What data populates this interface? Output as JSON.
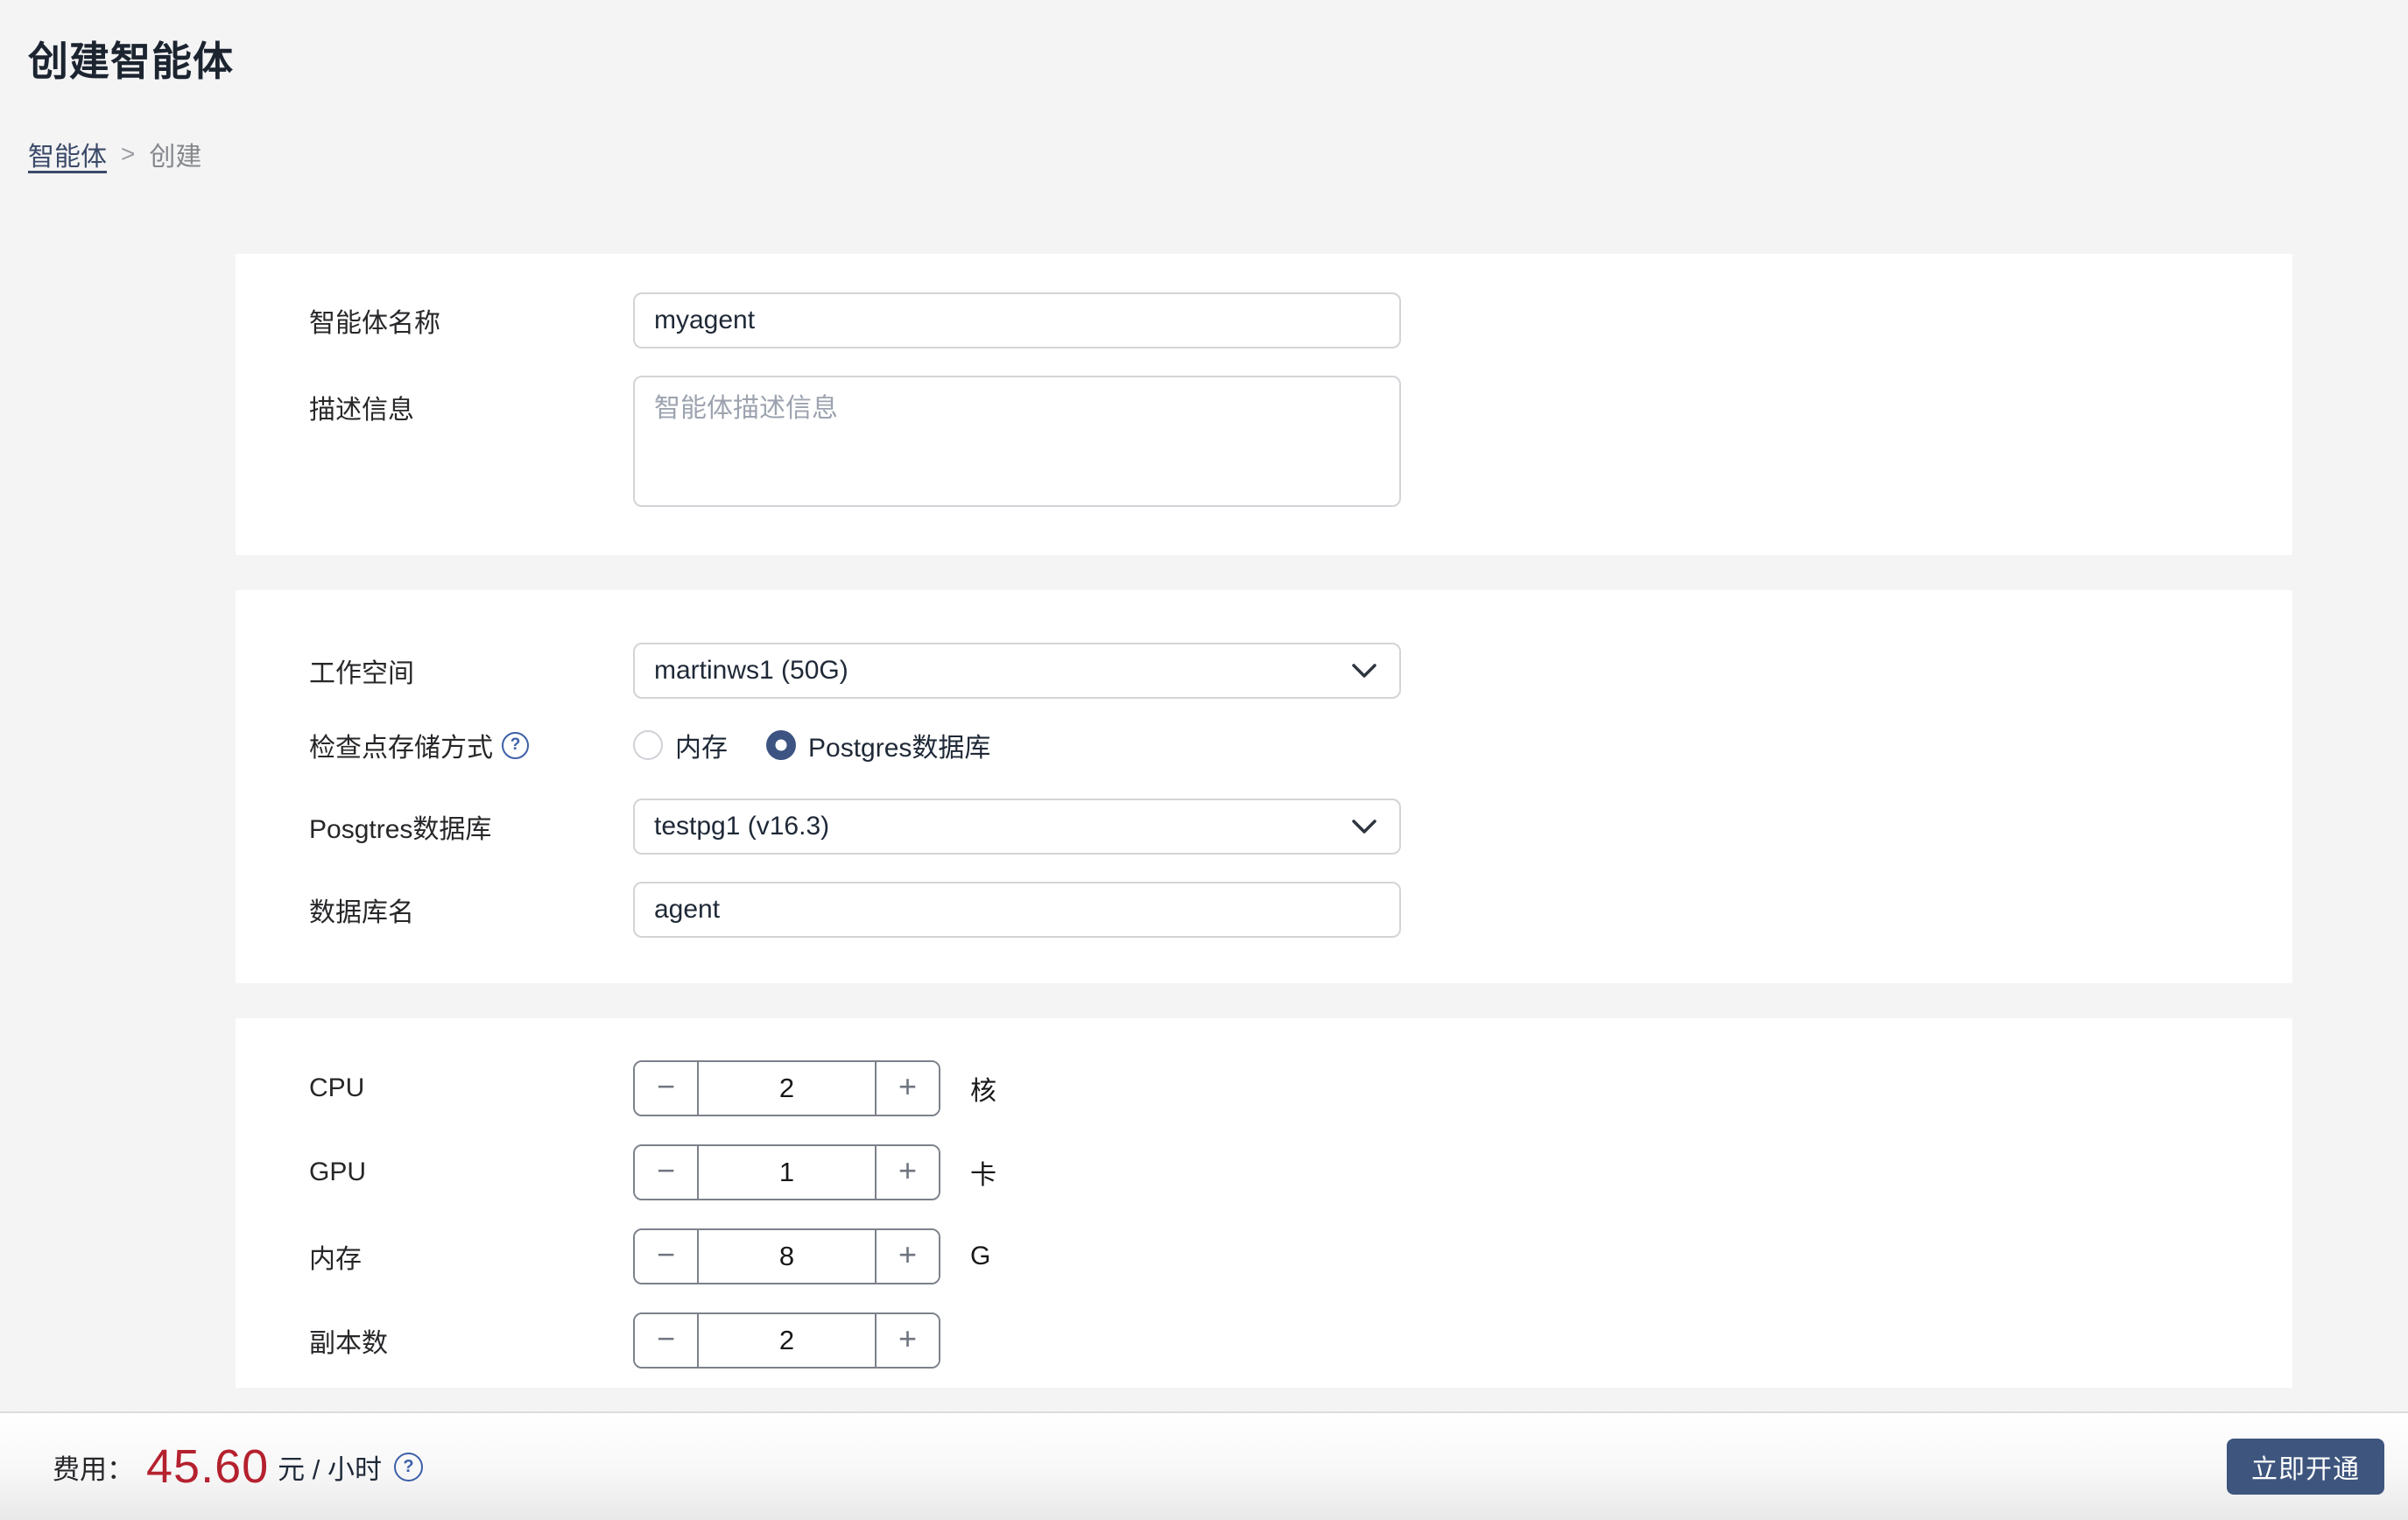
{
  "header": {
    "title": "创建智能体",
    "breadcrumb": {
      "parent": "智能体",
      "separator": ">",
      "current": "创建"
    }
  },
  "basic": {
    "name_label": "智能体名称",
    "name_value": "myagent",
    "desc_label": "描述信息",
    "desc_placeholder": "智能体描述信息"
  },
  "storage": {
    "workspace_label": "工作空间",
    "workspace_value": "martinws1 (50G)",
    "checkpoint_label": "检查点存储方式",
    "help_icon": "?",
    "options": [
      {
        "label": "内存",
        "selected": false
      },
      {
        "label": "Postgres数据库",
        "selected": true
      }
    ],
    "postgres_label": "Posgtres数据库",
    "postgres_value": "testpg1 (v16.3)",
    "dbname_label": "数据库名",
    "dbname_value": "agent"
  },
  "resources": {
    "minus_icon": "−",
    "plus_icon": "+",
    "rows": [
      {
        "label": "CPU",
        "value": "2",
        "unit": "核"
      },
      {
        "label": "GPU",
        "value": "1",
        "unit": "卡"
      },
      {
        "label": "内存",
        "value": "8",
        "unit": "G"
      },
      {
        "label": "副本数",
        "value": "2",
        "unit": ""
      }
    ]
  },
  "footer": {
    "fee_label": "费用：",
    "fee_value": "45.60",
    "fee_unit": "元 / 小时",
    "help_icon": "?",
    "submit_label": "立即开通"
  },
  "colors": {
    "page_bg": "#f4f4f5",
    "card_bg": "#ffffff",
    "radio_accent": "#3d5483",
    "button_blue": "#3e567e",
    "help_blue": "#3d5fa8",
    "fee_red": "#b5212e",
    "link_navy": "#3b4a68",
    "input_border": "#d4d4d8",
    "stepper_border": "#7c818b"
  }
}
